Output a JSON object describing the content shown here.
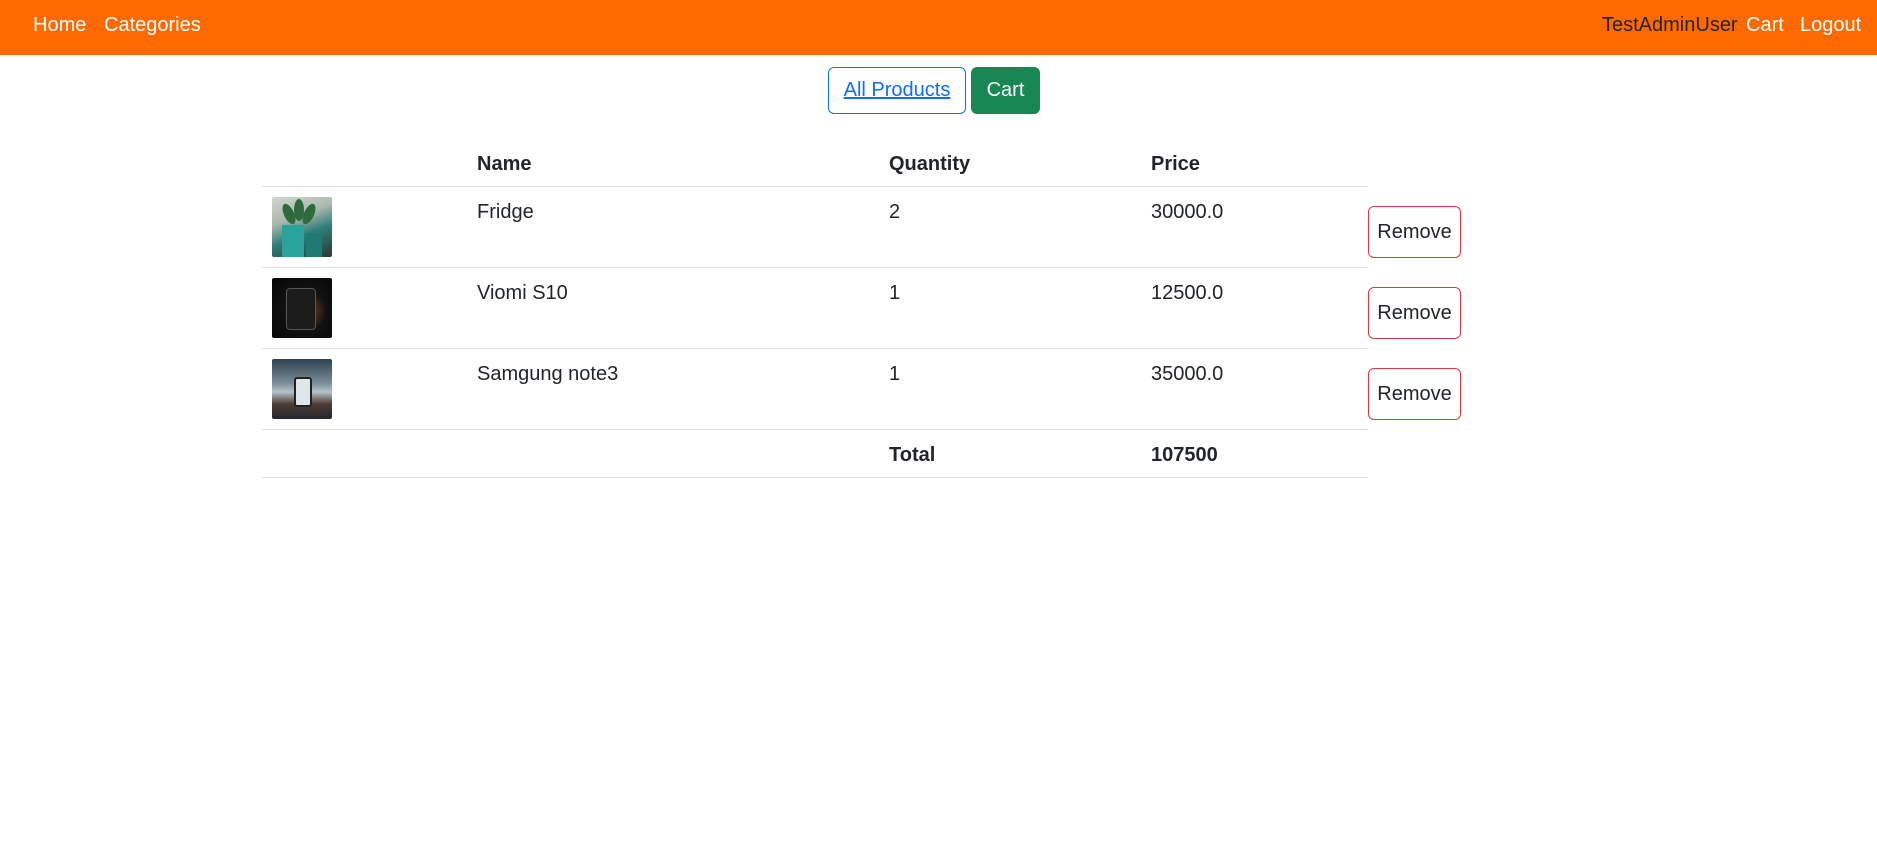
{
  "navbar": {
    "home": "Home",
    "categories": "Categories",
    "user": "TestAdminUser",
    "cart": "Cart",
    "logout": "Logout",
    "color": "#ff6a00"
  },
  "toolbar": {
    "all_products": "All Products",
    "cart": "Cart"
  },
  "table": {
    "headers": [
      "",
      "Name",
      "Quantity",
      "Price"
    ],
    "rows": [
      {
        "image": "fridge-thumbnail",
        "name": "Fridge",
        "quantity": "2",
        "price": "30000.0",
        "action": "Remove"
      },
      {
        "image": "phone-thumbnail",
        "name": "Viomi S10",
        "quantity": "1",
        "price": "12500.0",
        "action": "Remove"
      },
      {
        "image": "phone-thumbnail",
        "name": "Samgung note3",
        "quantity": "1",
        "price": "35000.0",
        "action": "Remove"
      }
    ],
    "total_label": "Total",
    "total_value": "107500"
  }
}
